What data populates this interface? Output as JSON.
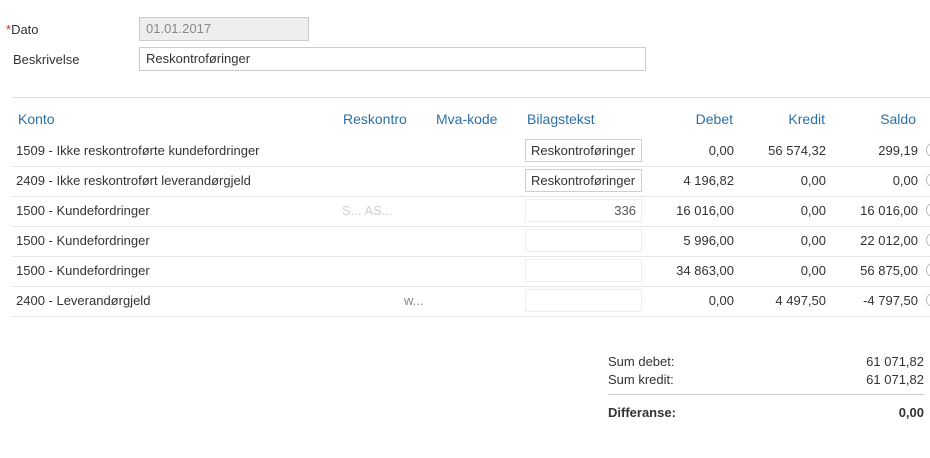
{
  "form": {
    "date_required_mark": "*",
    "date_label": "Dato",
    "date_value": "01.01.2017",
    "description_label": "Beskrivelse",
    "description_value": "Reskontroføringer"
  },
  "table": {
    "headers": {
      "konto": "Konto",
      "reskontro": "Reskontro",
      "mva": "Mva-kode",
      "bilagstekst": "Bilagstekst",
      "debet": "Debet",
      "kredit": "Kredit",
      "saldo": "Saldo"
    },
    "rows": [
      {
        "konto": "1509 - Ikke reskontroførte kundefordringer",
        "reskontro": "",
        "mva": "",
        "bilagstekst": "Reskontroføringer",
        "debet": "0,00",
        "kredit": "56 574,32",
        "saldo": "299,19"
      },
      {
        "konto": "2409 - Ikke reskontroført leverandørgjeld",
        "reskontro": "",
        "mva": "",
        "bilagstekst": "Reskontroføringer",
        "debet": "4 196,82",
        "kredit": "0,00",
        "saldo": "0,00"
      },
      {
        "konto": "1500 - Kundefordringer",
        "reskontro": "S... AS...",
        "mva": "",
        "bilagstekst": "336",
        "debet": "16 016,00",
        "kredit": "0,00",
        "saldo": "16 016,00"
      },
      {
        "konto": "1500 - Kundefordringer",
        "reskontro": "",
        "mva": "",
        "bilagstekst": "",
        "debet": "5 996,00",
        "kredit": "0,00",
        "saldo": "22 012,00"
      },
      {
        "konto": "1500 - Kundefordringer",
        "reskontro": "",
        "mva": "",
        "bilagstekst": "",
        "debet": "34 863,00",
        "kredit": "0,00",
        "saldo": "56 875,00"
      },
      {
        "konto": "2400 - Leverandørgjeld",
        "reskontro": "w...",
        "mva": "",
        "bilagstekst": "",
        "debet": "0,00",
        "kredit": "4 497,50",
        "saldo": "-4 797,50"
      }
    ]
  },
  "summary": {
    "sum_debet_label": "Sum debet:",
    "sum_debet_value": "61 071,82",
    "sum_kredit_label": "Sum kredit:",
    "sum_kredit_value": "61 071,82",
    "differanse_label": "Differanse:",
    "differanse_value": "0,00"
  }
}
